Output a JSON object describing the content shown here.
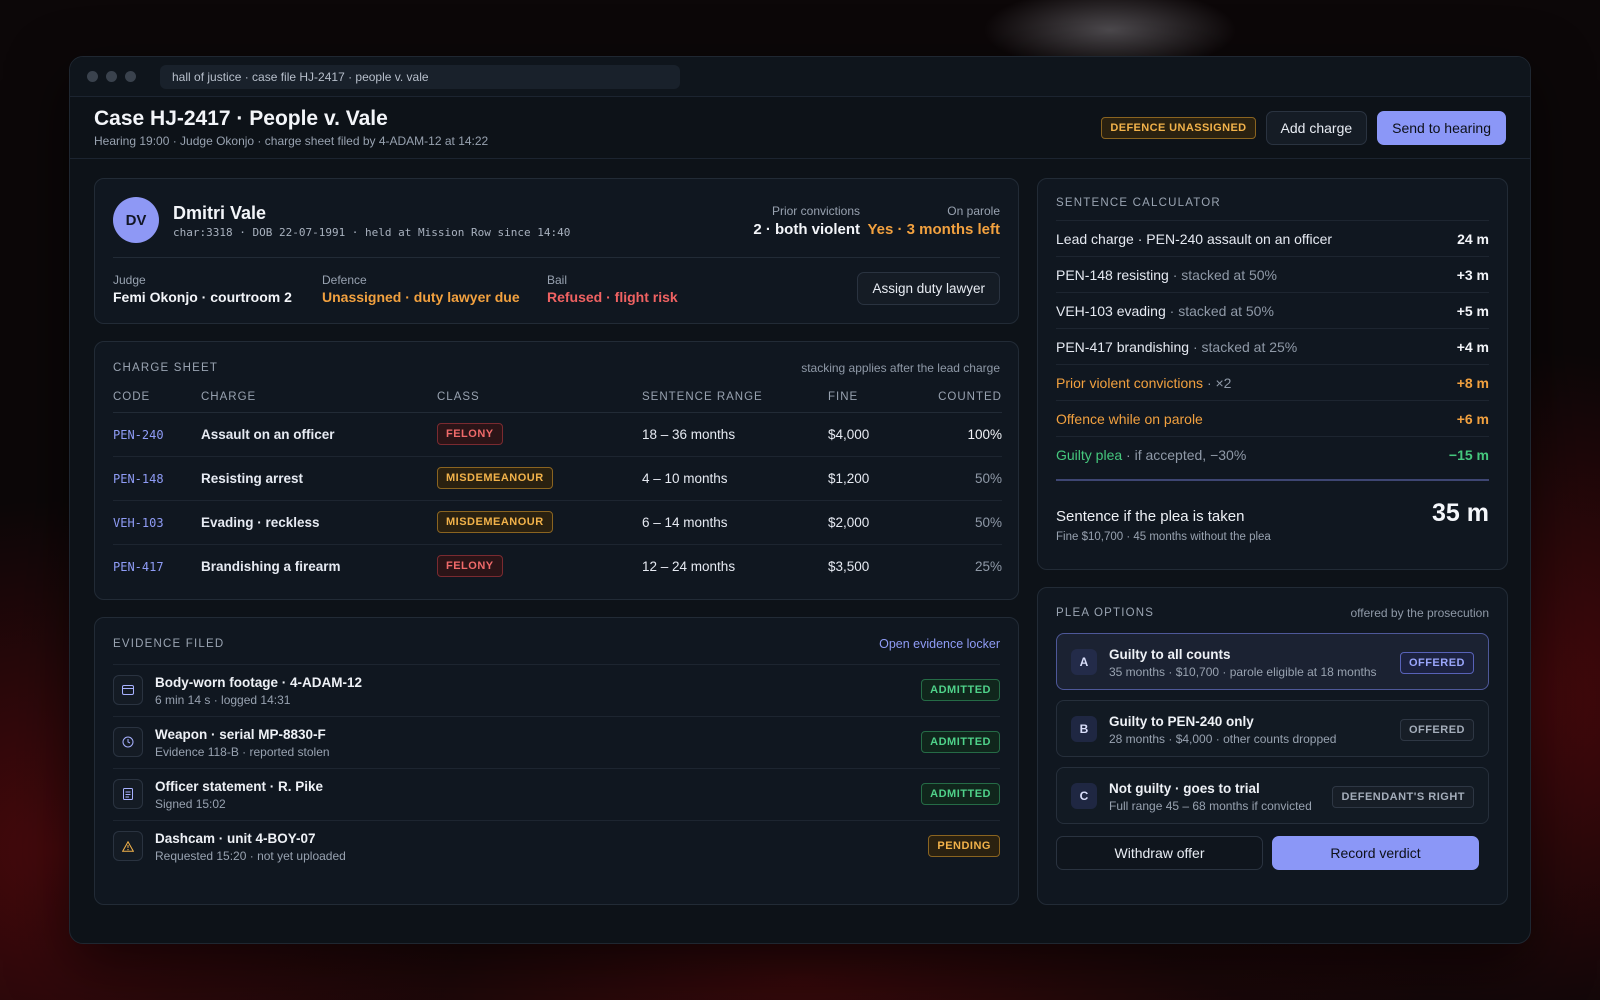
{
  "window": {
    "address": "hall of justice · case file HJ-2417 · people v. vale"
  },
  "header": {
    "title": "Case HJ-2417 · People v. Vale",
    "subtitle": "Hearing 19:00 · Judge Okonjo · charge sheet filed by 4-ADAM-12 at 14:22",
    "status_badge": "DEFENCE UNASSIGNED",
    "add_charge": "Add charge",
    "send_to_hearing": "Send to hearing"
  },
  "defendant": {
    "initials": "DV",
    "name": "Dmitri Vale",
    "meta": "char:3318 · DOB 22-07-1991 · held at Mission Row since 14:40",
    "prior_label": "Prior convictions",
    "prior_value": "2 · both violent",
    "parole_label": "On parole",
    "parole_value": "Yes · 3 months left",
    "judge_label": "Judge",
    "judge_value": "Femi Okonjo · courtroom 2",
    "defence_label": "Defence",
    "defence_value": "Unassigned · duty lawyer due",
    "bail_label": "Bail",
    "bail_value": "Refused · flight risk",
    "assign_button": "Assign duty lawyer"
  },
  "charge_sheet": {
    "title": "CHARGE SHEET",
    "note": "stacking applies after the lead charge",
    "columns": [
      "CODE",
      "CHARGE",
      "CLASS",
      "SENTENCE RANGE",
      "FINE",
      "COUNTED"
    ],
    "rows": [
      {
        "code": "PEN-240",
        "charge": "Assault on an officer",
        "class": "FELONY",
        "range": "18 – 36 months",
        "fine": "$4,000",
        "counted": "100%"
      },
      {
        "code": "PEN-148",
        "charge": "Resisting arrest",
        "class": "MISDEMEANOUR",
        "range": "4 – 10 months",
        "fine": "$1,200",
        "counted": "50%"
      },
      {
        "code": "VEH-103",
        "charge": "Evading · reckless",
        "class": "MISDEMEANOUR",
        "range": "6 – 14 months",
        "fine": "$2,000",
        "counted": "50%"
      },
      {
        "code": "PEN-417",
        "charge": "Brandishing a firearm",
        "class": "FELONY",
        "range": "12 – 24 months",
        "fine": "$3,500",
        "counted": "25%"
      }
    ]
  },
  "evidence": {
    "title": "EVIDENCE FILED",
    "open_locker": "Open evidence locker",
    "items": [
      {
        "icon": "video-icon",
        "title": "Body-worn footage · 4-ADAM-12",
        "sub": "6 min 14 s · logged 14:31",
        "status": "ADMITTED"
      },
      {
        "icon": "clock-icon",
        "title": "Weapon · serial MP-8830-F",
        "sub": "Evidence 118-B · reported stolen",
        "status": "ADMITTED"
      },
      {
        "icon": "document-icon",
        "title": "Officer statement · R. Pike",
        "sub": "Signed 15:02",
        "status": "ADMITTED"
      },
      {
        "icon": "warning-icon",
        "title": "Dashcam · unit 4-BOY-07",
        "sub": "Requested 15:20 · not yet uploaded",
        "status": "PENDING"
      }
    ]
  },
  "calculator": {
    "title": "SENTENCE CALCULATOR",
    "rows": [
      {
        "label": "Lead charge · PEN-240 assault on an officer",
        "note": "",
        "value": "24 m"
      },
      {
        "label": "PEN-148 resisting",
        "note": " · stacked at 50%",
        "value": "+3 m"
      },
      {
        "label": "VEH-103 evading",
        "note": " · stacked at 50%",
        "value": "+5 m"
      },
      {
        "label": "PEN-417 brandishing",
        "note": " · stacked at 25%",
        "value": "+4 m"
      },
      {
        "label": "Prior violent convictions",
        "note": " · ×2",
        "value": "+8 m"
      },
      {
        "label": "Offence while on parole",
        "note": "",
        "value": "+6 m"
      },
      {
        "label": "Guilty plea",
        "note": " · if accepted, −30%",
        "value": "−15 m"
      }
    ],
    "total_label": "Sentence if the plea is taken",
    "total_sub": "Fine $10,700 · 45 months without the plea",
    "total_value": "35 m"
  },
  "plea": {
    "title": "PLEA OPTIONS",
    "note": "offered by the prosecution",
    "options": [
      {
        "letter": "A",
        "title": "Guilty to all counts",
        "sub": "35 months · $10,700 · parole eligible at 18 months",
        "tag": "OFFERED"
      },
      {
        "letter": "B",
        "title": "Guilty to PEN-240 only",
        "sub": "28 months · $4,000 · other counts dropped",
        "tag": "OFFERED"
      },
      {
        "letter": "C",
        "title": "Not guilty · goes to trial",
        "sub": "Full range 45 – 68 months if convicted",
        "tag": "DEFENDANT'S RIGHT"
      }
    ],
    "withdraw": "Withdraw offer",
    "record": "Record verdict"
  }
}
